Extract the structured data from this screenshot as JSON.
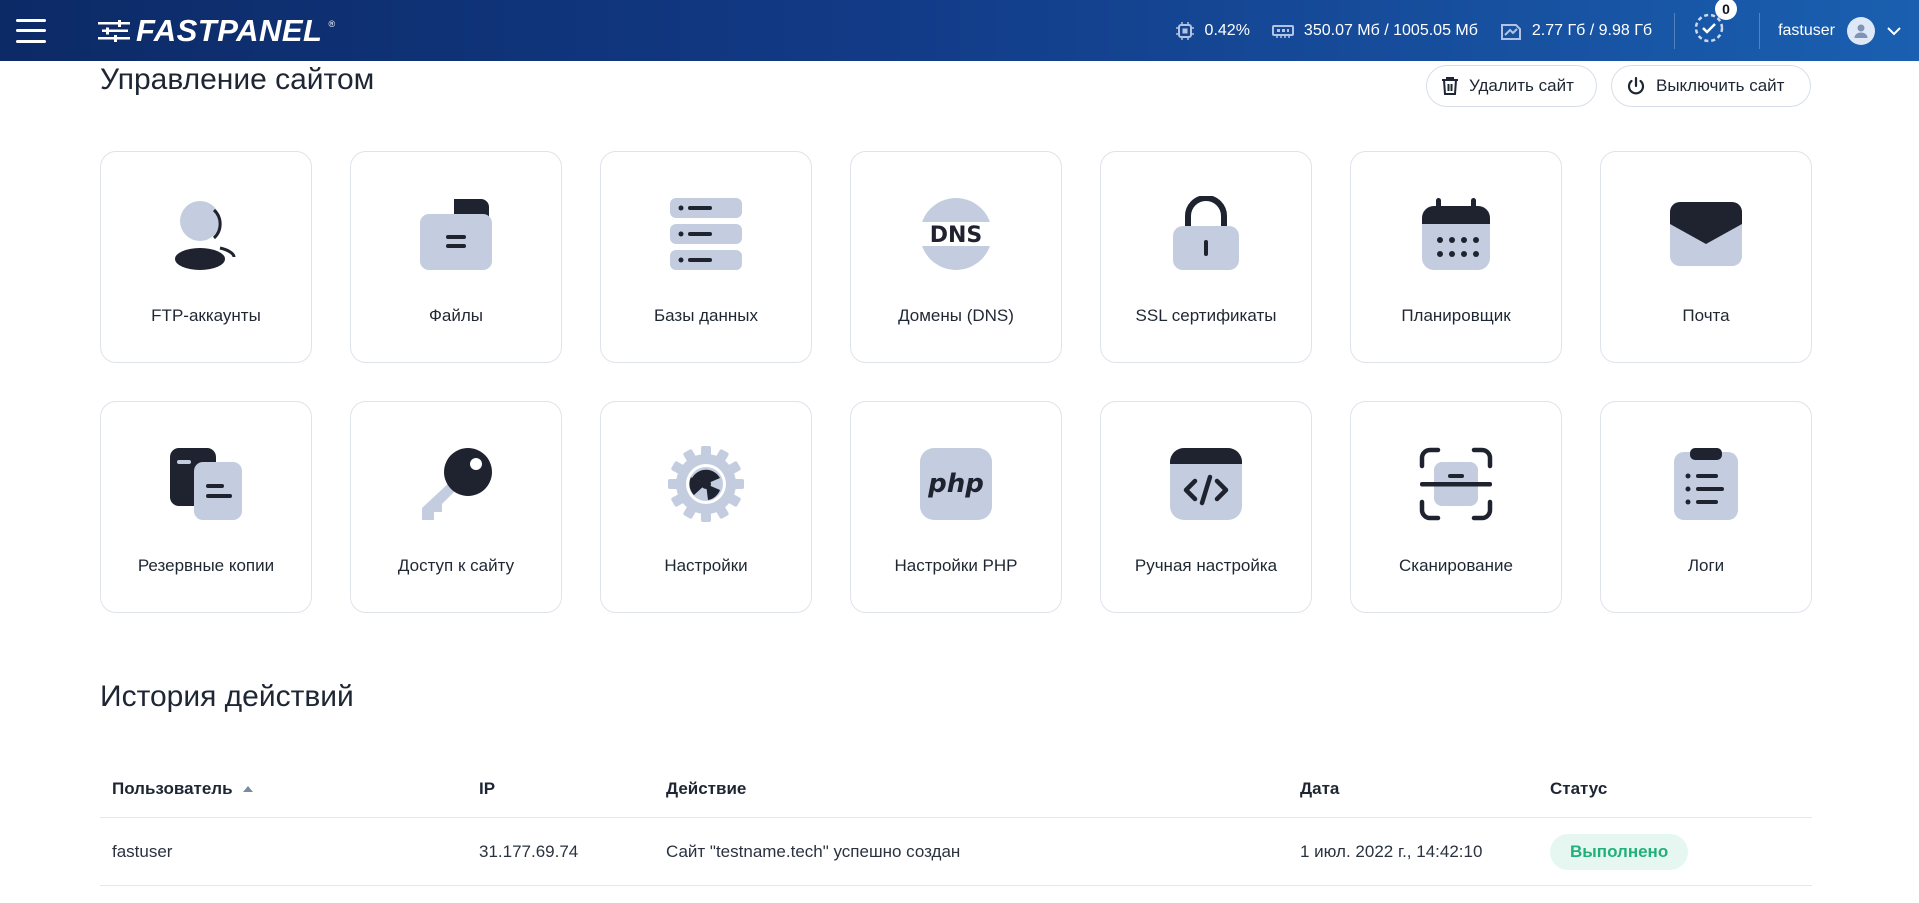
{
  "header": {
    "logo_text": "FASTPANEL",
    "logo_reg": "®",
    "cpu": "0.42%",
    "ram": "350.07 Мб / 1005.05 Мб",
    "disk": "2.77 Гб / 9.98 Гб",
    "tasks_count": "0",
    "username": "fastuser"
  },
  "site": {
    "title": "Управление сайтом",
    "delete_label": "Удалить сайт",
    "disable_label": "Выключить сайт"
  },
  "tiles": [
    {
      "label": "FTP-аккаунты",
      "icon": "ftp-users-icon"
    },
    {
      "label": "Файлы",
      "icon": "folder-icon"
    },
    {
      "label": "Базы данных",
      "icon": "database-icon"
    },
    {
      "label": "Домены (DNS)",
      "icon": "dns-icon"
    },
    {
      "label": "SSL сертификаты",
      "icon": "lock-icon"
    },
    {
      "label": "Планировщик",
      "icon": "calendar-icon"
    },
    {
      "label": "Почта",
      "icon": "mail-icon"
    },
    {
      "label": "Резервные копии",
      "icon": "backup-icon"
    },
    {
      "label": "Доступ к сайту",
      "icon": "key-icon"
    },
    {
      "label": "Настройки",
      "icon": "gear-icon"
    },
    {
      "label": "Настройки PHP",
      "icon": "php-icon"
    },
    {
      "label": "Ручная настройка",
      "icon": "code-icon"
    },
    {
      "label": "Сканирование",
      "icon": "scan-icon"
    },
    {
      "label": "Логи",
      "icon": "logs-icon"
    }
  ],
  "history": {
    "title": "История действий",
    "columns": [
      "Пользователь",
      "IP",
      "Действие",
      "Дата",
      "Статус"
    ],
    "rows": [
      {
        "user": "fastuser",
        "ip": "31.177.69.74",
        "action": "Сайт \"testname.tech\" успешно создан",
        "date": "1 июл. 2022 г., 14:42:10",
        "status": "Выполнено"
      }
    ]
  },
  "colors": {
    "accent": "#1a5fb0",
    "icon_light": "#c3cddf",
    "icon_dark": "#1f2330",
    "status_ok": "#22b07a"
  }
}
